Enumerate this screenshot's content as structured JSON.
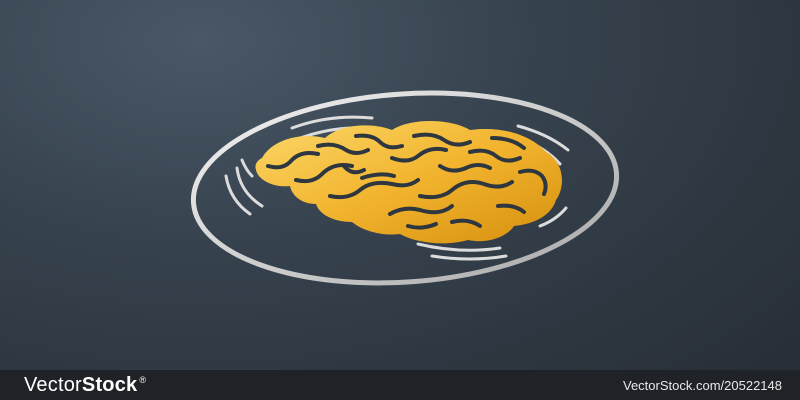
{
  "image": {
    "subject": "brain-icon",
    "frame": "ellipse-ring-icon",
    "colors": {
      "background_top": "#4a5866",
      "background_bottom": "#262c33",
      "ring": "#d6d6d6",
      "brain_light": "#f6c64a",
      "brain_dark": "#d89a12",
      "folds": "#2e363f",
      "footer": "#1f2327"
    }
  },
  "footer": {
    "brand_light": "Vector",
    "brand_bold": "Stock",
    "brand_reg": "®",
    "credit": "VectorStock.com/20522148"
  }
}
